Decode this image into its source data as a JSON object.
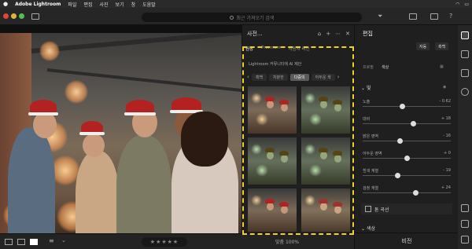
{
  "macbar": {
    "apple": "",
    "app_name": "Adobe Lightroom",
    "menus": [
      "파일",
      "편집",
      "사진",
      "보기",
      "창",
      "도움말"
    ]
  },
  "toolbar": {
    "search_placeholder": "최근 가져오기 검색"
  },
  "presets_panel": {
    "title": "사전...",
    "tabs": [
      "권장",
      "Premium",
      "사용자 버전"
    ],
    "ai_label": "Lightroom 커뮤니티에 AI 제안",
    "chips": [
      "흑백",
      "차분한",
      "다중의",
      "어두운 색"
    ],
    "selected_chip_index": 2
  },
  "edit_panel": {
    "title": "편집",
    "auto_button": "자동",
    "bw_button": "흑백",
    "profile_label": "프로필",
    "profile_value": "색상",
    "light_section": "빛",
    "sliders": [
      {
        "label": "노출",
        "value": "- 0.62",
        "pos": 0.45
      },
      {
        "label": "대비",
        "value": "+ 18",
        "pos": 0.58
      },
      {
        "label": "밝은 영역",
        "value": "- 16",
        "pos": 0.42
      },
      {
        "label": "어두운 영역",
        "value": "+ 0",
        "pos": 0.5
      },
      {
        "label": "흰색 계열",
        "value": "- 19",
        "pos": 0.4
      },
      {
        "label": "검정 계열",
        "value": "+ 24",
        "pos": 0.6
      }
    ],
    "curve_label": "톤 곡선",
    "color_section": "색상",
    "compare_button": "비전"
  },
  "bottom_bar": {
    "stars": "★★★★★",
    "zoom_text": "맞춤 100%"
  }
}
